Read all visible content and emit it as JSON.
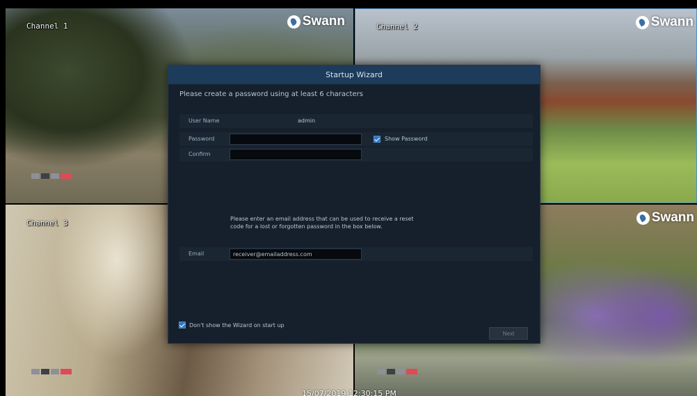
{
  "cameras": [
    {
      "label": "Channel 1",
      "brand": "Swann"
    },
    {
      "label": "Channel 2",
      "brand": "Swann"
    },
    {
      "label": "Channel 3",
      "brand": ""
    },
    {
      "label": "",
      "brand": "Swann"
    }
  ],
  "timestamp": "15/07/2019 12:30:15 PM",
  "wizard": {
    "title": "Startup Wizard",
    "instruction": "Please create a password using at least 6 characters",
    "username_label": "User Name",
    "username_value": "admin",
    "password_label": "Password",
    "password_value": "",
    "show_password_label": "Show Password",
    "confirm_label": "Confirm",
    "confirm_value": "",
    "hint": "Please enter an email address that can be used to receive a reset code for a lost or forgotten password in the box below.",
    "email_label": "Email",
    "email_value": "receiver@emailaddress.com",
    "dont_show_label": "Don't show the Wizard on start up",
    "next_label": "Next"
  },
  "colors": {
    "title_bar": "#1d3b5b",
    "panel_bg": "#16202c",
    "checkbox": "#2f78c4",
    "record_indicator": "#e04a56"
  }
}
